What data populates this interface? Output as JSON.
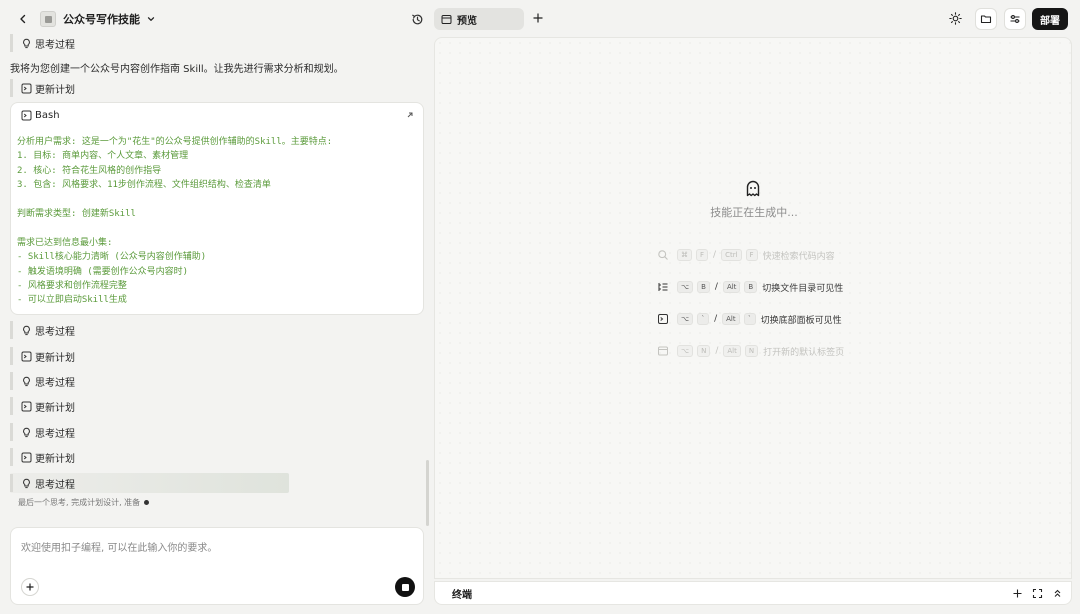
{
  "header": {
    "project_name": "公众号写作技能"
  },
  "chat": {
    "steps": [
      {
        "type": "thinking",
        "label": "思考过程"
      },
      {
        "type": "plan",
        "label": "更新计划"
      }
    ],
    "intro_text": "我将为您创建一个公众号内容创作指南 Skill。让我先进行需求分析和规划。",
    "bash": {
      "title": "Bash",
      "lines": [
        "分析用户需求: 这是一个为\"花生\"的公众号提供创作辅助的Skill。主要特点:",
        "1. 目标: 商单内容、个人文章、素材管理",
        "2. 核心: 符合花生风格的创作指导",
        "3. 包含: 风格要求、11步创作流程、文件组织结构、检查清单",
        "",
        "判断需求类型: 创建新Skill",
        "",
        "需求已达到信息最小集:",
        "- Skill核心能力清晰 (公众号内容创作辅助)",
        "- 触发语境明确 (需要创作公众号内容时)",
        "- 风格要求和创作流程完整",
        "- 可以立即启动Skill生成"
      ]
    },
    "later_steps": [
      {
        "type": "thinking",
        "label": "思考过程"
      },
      {
        "type": "plan",
        "label": "更新计划"
      },
      {
        "type": "thinking",
        "label": "思考过程"
      },
      {
        "type": "plan",
        "label": "更新计划"
      },
      {
        "type": "thinking",
        "label": "思考过程"
      },
      {
        "type": "plan",
        "label": "更新计划"
      },
      {
        "type": "thinking",
        "label": "思考过程"
      }
    ],
    "thinking_status": "最后一个思考, 完成计划设计, 准备"
  },
  "input": {
    "placeholder": "欢迎使用扣子编程, 可以在此输入你的要求。"
  },
  "preview": {
    "tab_label": "预览",
    "status_text": "技能正在生成中...",
    "shortcuts": [
      {
        "icon": "search-icon",
        "keys_mac": [
          "⌘",
          "F"
        ],
        "keys_win": [
          "Ctrl",
          "F"
        ],
        "label": "快速检索代码内容"
      },
      {
        "icon": "file-tree-icon",
        "keys_mac": [
          "⌥",
          "B"
        ],
        "keys_win": [
          "Alt",
          "B"
        ],
        "label": "切换文件目录可见性"
      },
      {
        "icon": "terminal-icon",
        "keys_mac": [
          "⌥",
          "`"
        ],
        "keys_win": [
          "Alt",
          "`"
        ],
        "label": "切换底部面板可见性"
      },
      {
        "icon": "window-icon",
        "keys_mac": [
          "⌥",
          "N"
        ],
        "keys_win": [
          "Alt",
          "N"
        ],
        "label": "打开新的默认标签页"
      }
    ]
  },
  "toolbar": {
    "deploy_label": "部署"
  },
  "terminal": {
    "label": "终端"
  },
  "colors": {
    "accent_dark": "#161616",
    "bash_text": "#5a9a3a",
    "background": "#f3f3f1"
  }
}
